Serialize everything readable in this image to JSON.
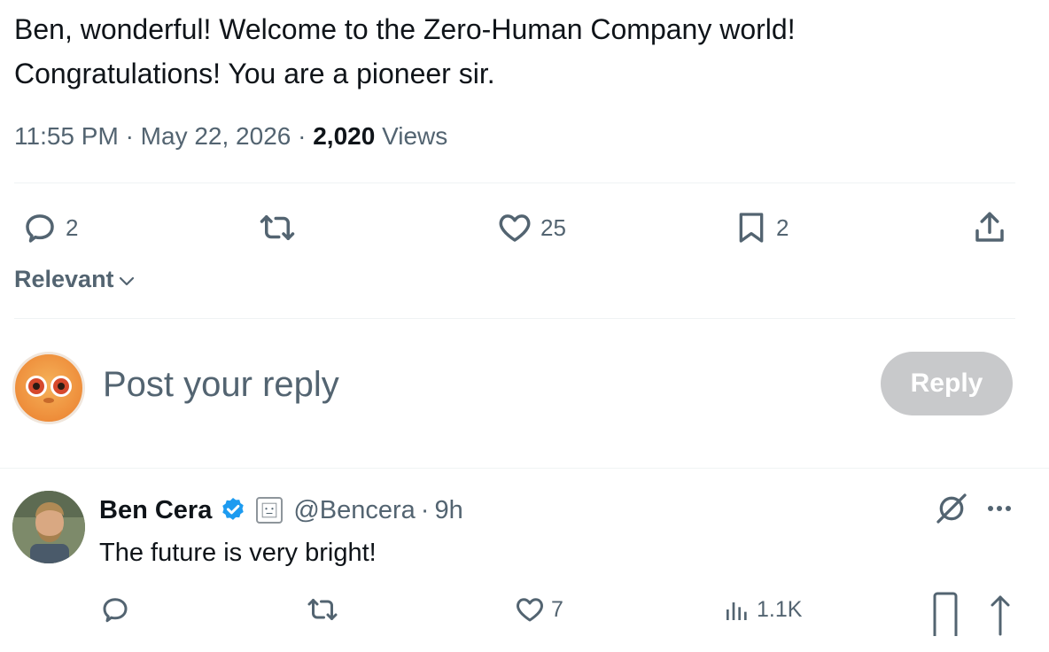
{
  "tweet": {
    "text_line1": "Ben, wonderful! Welcome to the Zero-Human Company world!",
    "text_line2": "Congratulations! You are a pioneer sir.",
    "time": "11:55 PM",
    "date": "May 22, 2026",
    "dot": "·",
    "views_count": "2,020",
    "views_label": "Views"
  },
  "actions": {
    "replies": "2",
    "retweets": "",
    "likes": "25",
    "bookmarks": "2"
  },
  "sort": {
    "label": "Relevant"
  },
  "composer": {
    "placeholder": "Post your reply",
    "reply_button": "Reply"
  },
  "reply": {
    "name": "Ben Cera",
    "handle": "@Bencera",
    "dot": "·",
    "age": "9h",
    "text": "The future is very bright!",
    "likes": "7",
    "views": "1.1K"
  },
  "icons": {
    "reply": "speech-bubble-icon",
    "retweet": "retweet-icon",
    "like": "heart-icon",
    "bookmark": "bookmark-icon",
    "share": "share-upload-icon",
    "views": "bar-chart-icon",
    "grok": "grok-icon",
    "more": "more-dots-icon",
    "verified": "verified-badge-icon",
    "chevron": "chevron-down-icon"
  },
  "colors": {
    "text": "#0f1419",
    "secondary": "#536471",
    "verified": "#1d9bf0",
    "reply_button_disabled": "#c8c9cb",
    "divider": "#eff3f4"
  }
}
